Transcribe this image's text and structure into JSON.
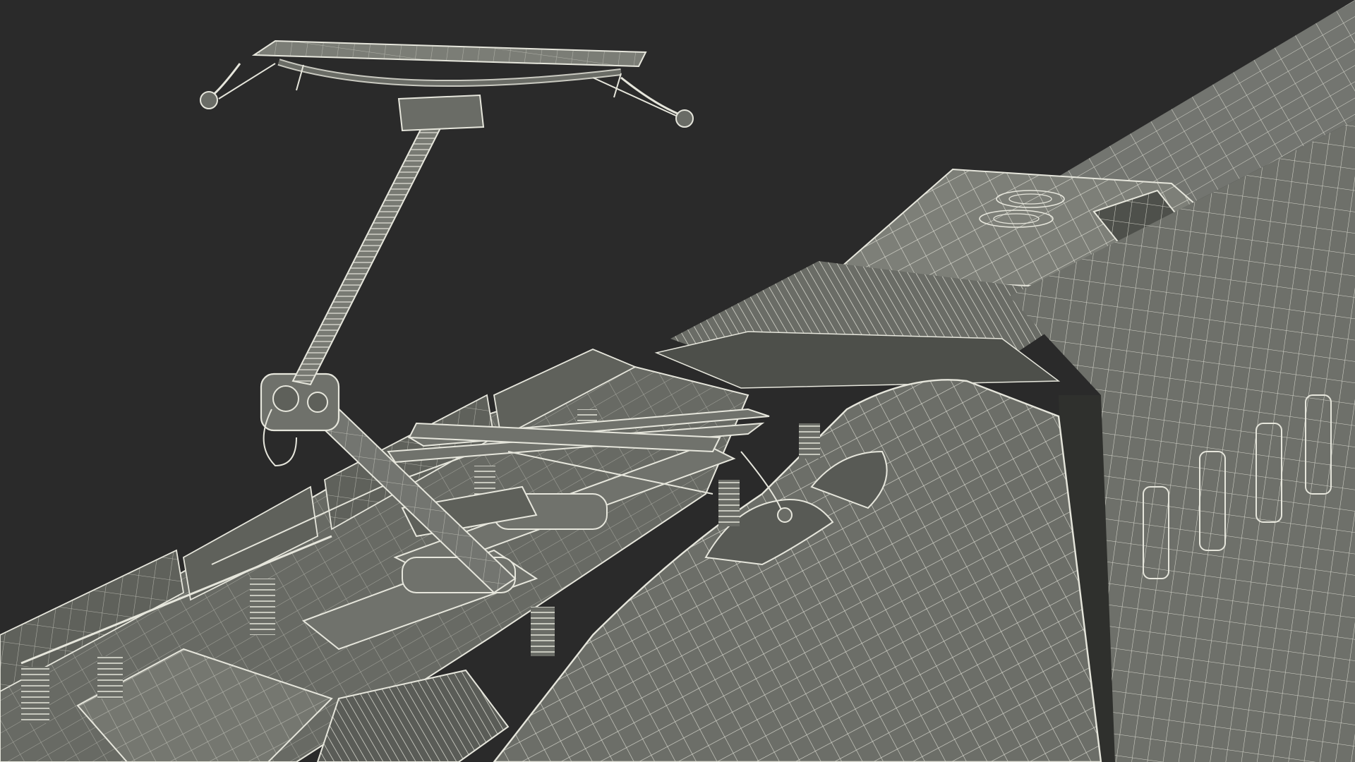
{
  "scene": {
    "subject": "pantograph-on-train-roof-wireframe",
    "render_style": "wireframe-clay",
    "colors": {
      "background": "#2a2a2a",
      "surface": "#6a6c66",
      "surface_light": "#7c7e77",
      "surface_dark": "#50524d",
      "wire": "#e6e6dc",
      "wire_dim": "#b9b9ae"
    }
  }
}
